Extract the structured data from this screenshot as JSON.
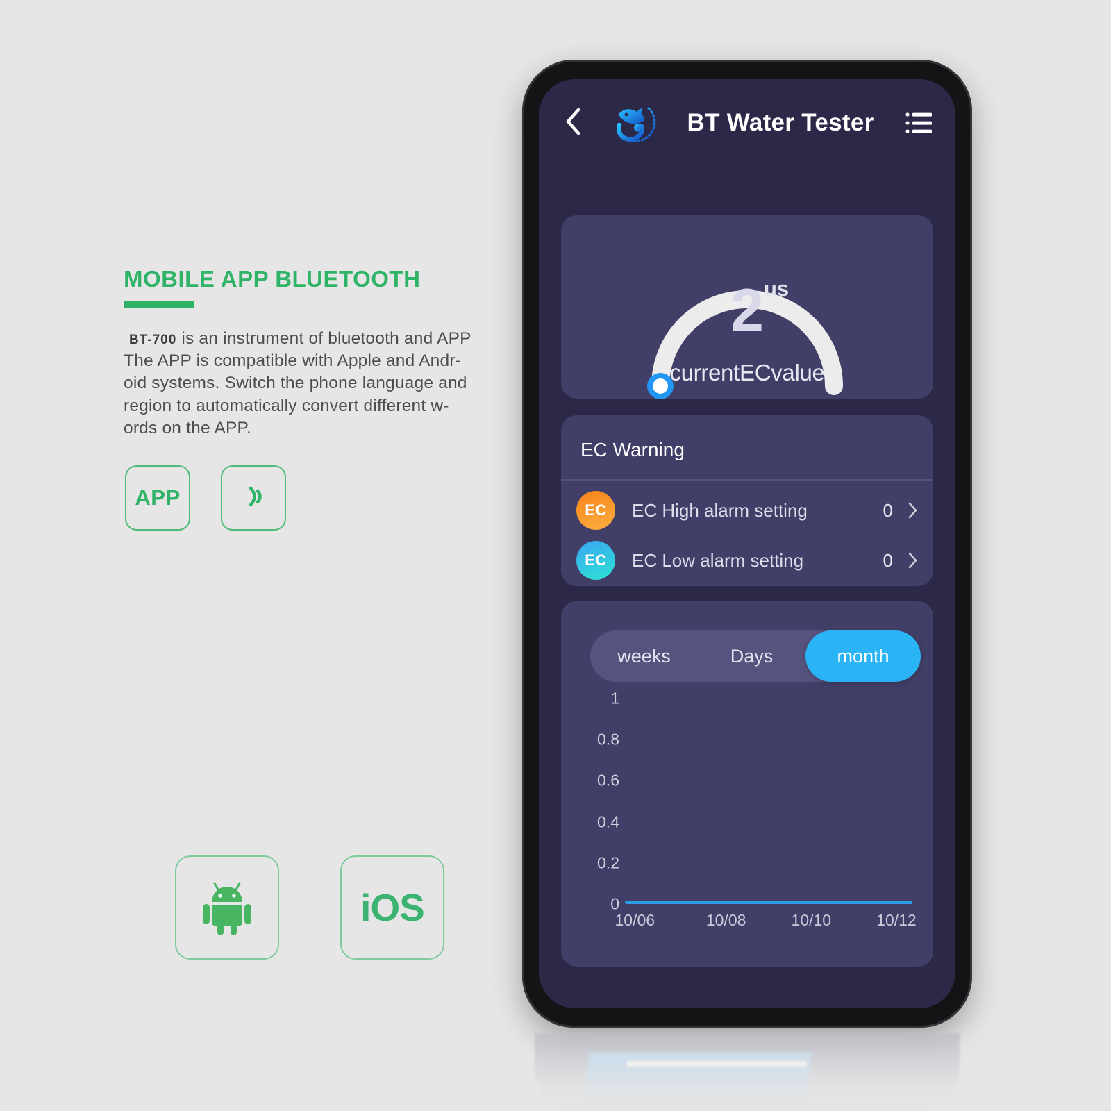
{
  "page": {
    "background_color": "#e6e6e6",
    "accent_green": "#2eb367"
  },
  "marketing": {
    "headline": "MOBILE APP BLUETOOTH",
    "model_tag": "BT-700",
    "body": "is an instrument of bluetooth and APP The APP is compatible with Apple and Android systems. Switch the phone language and region to automatically convert different words on the APP.",
    "body_lines": [
      "is an instrument of bluetooth and APP",
      "The APP is compatible with Apple and Andr-",
      "oid systems. Switch the phone language and",
      "region to automatically convert different w-",
      "ords on the APP."
    ],
    "feature_badges": [
      {
        "label": "APP",
        "icon": "app-text-badge"
      },
      {
        "label": "",
        "icon": "wireless-waves-icon"
      }
    ],
    "store_badges": [
      {
        "label": "",
        "icon": "android-robot-icon"
      },
      {
        "label": "iOS",
        "icon": "ios-text-badge"
      }
    ]
  },
  "phone": {
    "screen_bg": "#2b2848",
    "card_bg": "#413e67",
    "header": {
      "back_icon": "chevron-left-icon",
      "logo_icon": "fish-logo-icon",
      "title": "BT Water Tester",
      "menu_icon": "list-menu-icon"
    },
    "gauge": {
      "value": "2",
      "unit": "us",
      "label": "currentECvalue",
      "arc_color": "#ececec",
      "knob_color": "#2196f3"
    },
    "warning_card": {
      "title": "EC Warning",
      "rows": [
        {
          "badge": "EC",
          "badge_style": "orange",
          "label": "EC High alarm setting",
          "value": "0",
          "arrow": "chevron-right-icon"
        },
        {
          "badge": "EC",
          "badge_style": "cyan",
          "label": "EC Low alarm setting",
          "value": "0",
          "arrow": "chevron-right-icon"
        }
      ]
    },
    "chart_card": {
      "segments": [
        {
          "label": "weeks",
          "active": false
        },
        {
          "label": "Days",
          "active": false
        },
        {
          "label": "month",
          "active": true
        }
      ],
      "active_color": "#2bb4f5"
    }
  },
  "chart_data": {
    "type": "line",
    "title": "",
    "xlabel": "",
    "ylabel": "",
    "x": [
      "10/06",
      "10/08",
      "10/10",
      "10/12"
    ],
    "y_ticks": [
      "1",
      "0.8",
      "0.6",
      "0.4",
      "0.2",
      "0"
    ],
    "ylim": [
      0,
      1
    ],
    "grid": false,
    "legend": "none",
    "series": [
      {
        "name": "EC",
        "color": "#2b9ee6",
        "values": [
          0,
          0,
          0,
          0
        ]
      }
    ]
  }
}
